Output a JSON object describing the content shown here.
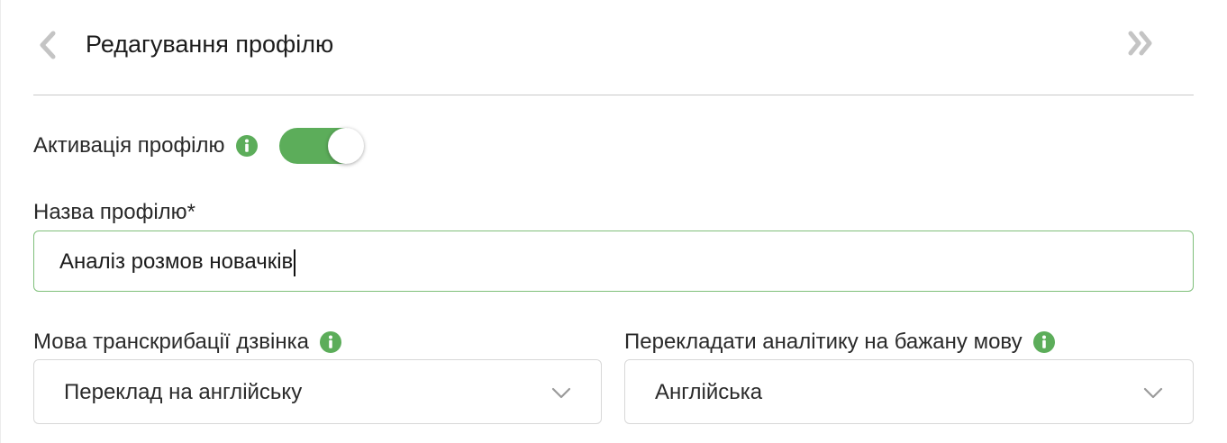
{
  "header": {
    "title": "Редагування профілю",
    "back_icon": "chevron-left-icon",
    "collapse_icon": "double-chevron-right-icon"
  },
  "activation": {
    "label": "Активація профілю",
    "info_icon": "info-icon",
    "enabled": true
  },
  "profile_name": {
    "label": "Назва профілю*",
    "value": "Аналіз розмов новачків"
  },
  "transcription_language": {
    "label": "Мова транскрибації дзвінка",
    "selected": "Переклад на англійську"
  },
  "analytics_language": {
    "label": "Перекладати аналітику на бажану мову",
    "selected": "Англійська"
  },
  "colors": {
    "accent": "#5cad5a",
    "icon_gray": "#c4c4c4",
    "divider": "#c9c9c9"
  }
}
